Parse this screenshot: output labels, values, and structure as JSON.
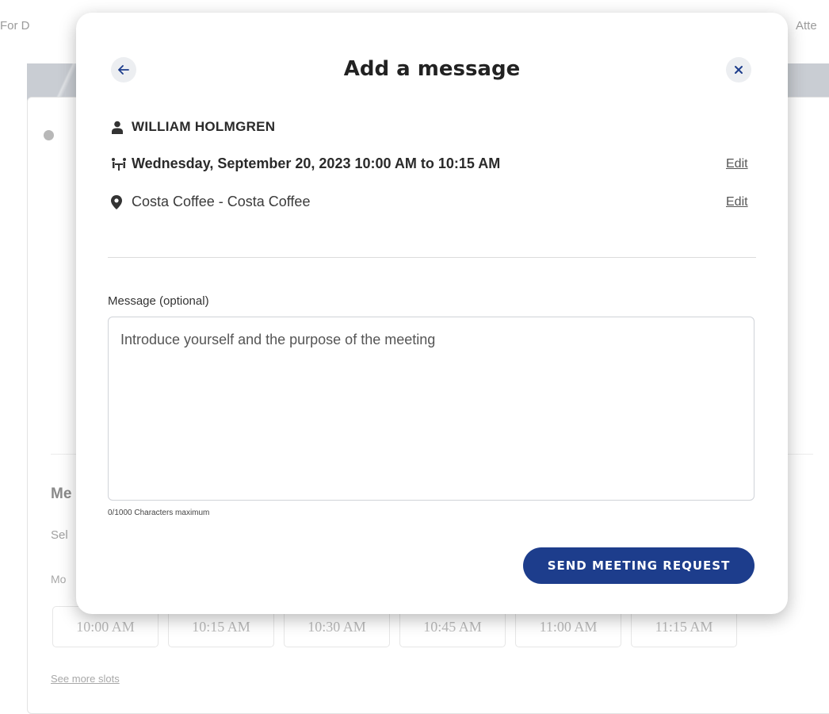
{
  "background": {
    "tab_left": "For D",
    "tab_right": "Atte",
    "section_heading": "Me",
    "section_sub": "Sel",
    "day_label": "Mo",
    "slots": [
      "10:00 AM",
      "10:15 AM",
      "10:30 AM",
      "10:45 AM",
      "11:00 AM",
      "11:15 AM"
    ],
    "see_more_link": "See more slots"
  },
  "modal": {
    "title": "Add a message",
    "back_icon": "arrow-left-icon",
    "close_icon": "close-icon",
    "attendee": {
      "icon": "person-icon",
      "name": "WILLIAM HOLMGREN"
    },
    "datetime": {
      "icon": "meeting-table-icon",
      "text": "Wednesday, September 20, 2023 10:00 AM to 10:15 AM",
      "edit_label": "Edit"
    },
    "location": {
      "icon": "map-pin-icon",
      "text": "Costa Coffee - Costa Coffee",
      "edit_label": "Edit"
    },
    "message": {
      "label": "Message (optional)",
      "placeholder": "Introduce yourself and the purpose of the meeting",
      "value": "",
      "char_count": "0/1000 Characters maximum"
    },
    "send_button_label": "SEND MEETING REQUEST"
  },
  "colors": {
    "primary_button": "#1d3d8c",
    "banner": "#c9cdd3"
  }
}
